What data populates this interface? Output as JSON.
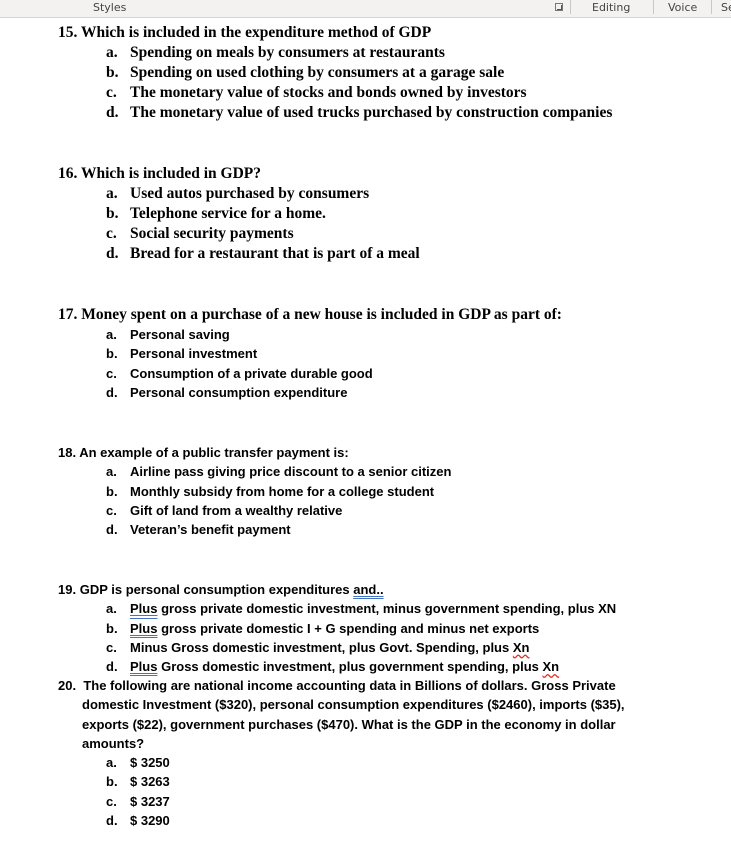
{
  "ribbon": {
    "styles_label": "Styles",
    "editing_label": "Editing",
    "voice_label": "Voice",
    "cut_label": "Se"
  },
  "questions": [
    {
      "number": "15.",
      "stem": "Which is included in the expenditure method of GDP",
      "options": [
        {
          "letter": "a.",
          "text": "Spending on meals by consumers at restaurants"
        },
        {
          "letter": "b.",
          "text": "Spending on used clothing by consumers at a garage sale"
        },
        {
          "letter": "c.",
          "text": "The monetary value of stocks and bonds owned by investors"
        },
        {
          "letter": "d.",
          "text": "The monetary value of used trucks purchased by construction companies"
        }
      ]
    },
    {
      "number": "16.",
      "stem": "Which is included in GDP?",
      "options": [
        {
          "letter": "a.",
          "text": "Used autos purchased by consumers"
        },
        {
          "letter": "b.",
          "text": "Telephone service for a home."
        },
        {
          "letter": "c.",
          "text": "Social security payments"
        },
        {
          "letter": "d.",
          "text": "Bread for a restaurant that is part of a meal"
        }
      ]
    },
    {
      "number": "17.",
      "stem": "Money spent on a purchase of a new house is included in GDP as part of:",
      "options": [
        {
          "letter": "a.",
          "text": "Personal saving"
        },
        {
          "letter": "b.",
          "text": "Personal investment"
        },
        {
          "letter": "c.",
          "text": "Consumption of a private durable good"
        },
        {
          "letter": "d.",
          "text": "Personal consumption expenditure"
        }
      ]
    },
    {
      "number": "18.",
      "stem": "An example of a public transfer payment is:",
      "options": [
        {
          "letter": "a.",
          "text": "Airline pass giving price discount to a senior citizen"
        },
        {
          "letter": "b.",
          "text": "Monthly subsidy from home for a college student"
        },
        {
          "letter": "c.",
          "text": "Gift of land from a wealthy relative"
        },
        {
          "letter": "d.",
          "text": "Veteran’s benefit payment"
        }
      ]
    },
    {
      "number": "19.",
      "stem_pre": "GDP is personal consumption expenditures ",
      "stem_flag": "and..",
      "options": [
        {
          "letter": "a.",
          "flag": "Plus",
          "text": " gross private domestic investment, minus government spending, plus XN"
        },
        {
          "letter": "b.",
          "flag": "Plus",
          "text": " gross private domestic I + G spending and minus net exports"
        },
        {
          "letter": "c.",
          "text": "Minus Gross domestic investment, plus Govt. Spending, plus ",
          "spell": "Xn"
        },
        {
          "letter": "d.",
          "flag": "Plus",
          "text": " Gross domestic investment, plus government spending, plus ",
          "spell": "Xn"
        }
      ]
    },
    {
      "number": "20.",
      "stem": "The following are national income accounting data in Billions of dollars. Gross Private domestic Investment ($320), personal consumption expenditures ($2460), imports ($35), exports ($22), government purchases ($470). What is the GDP in the economy in dollar amounts?",
      "options": [
        {
          "letter": "a.",
          "text": "$ 3250"
        },
        {
          "letter": "b.",
          "text": "$ 3263"
        },
        {
          "letter": "c.",
          "text": "$ 3237"
        },
        {
          "letter": "d.",
          "text": "$ 3290"
        }
      ]
    }
  ]
}
